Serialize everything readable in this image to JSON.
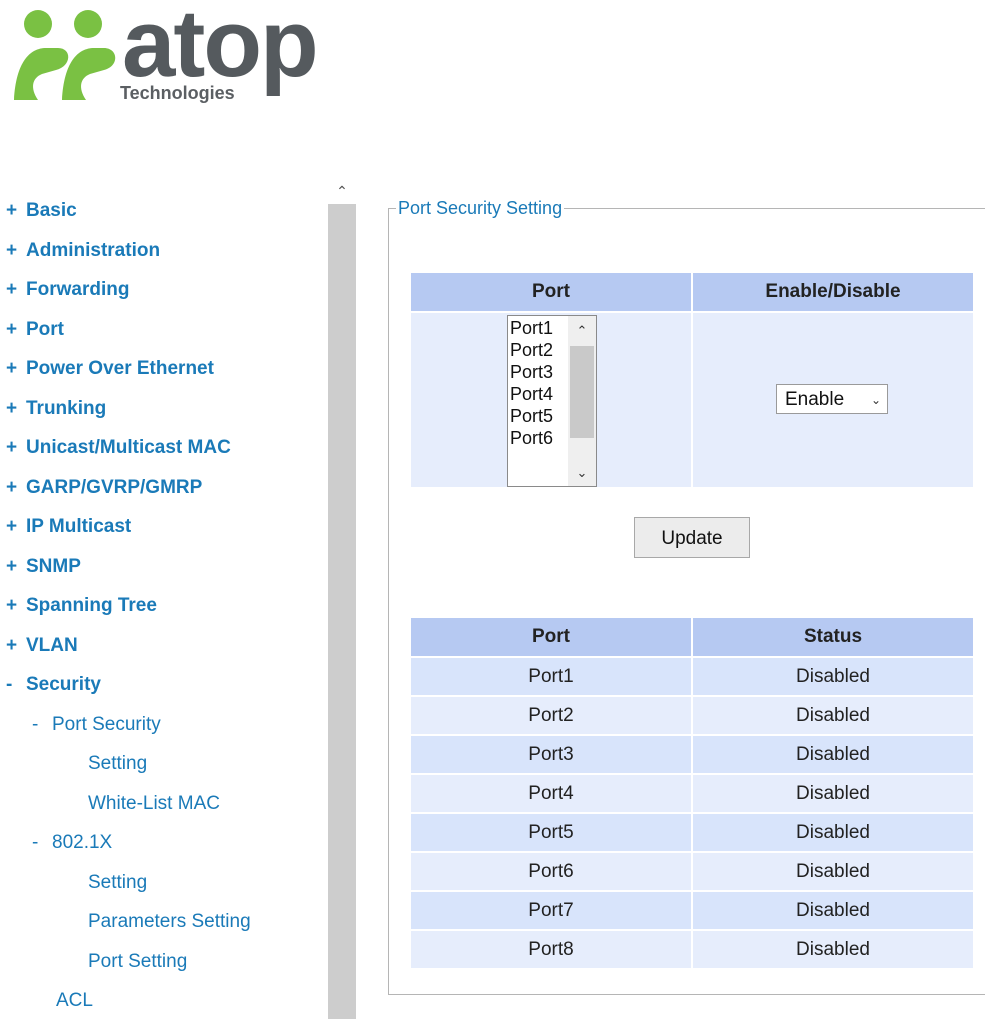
{
  "logo": {
    "wordmark": "atop",
    "tagline": "Technologies",
    "brand_color": "#7ac143",
    "text_color": "#555a5e"
  },
  "sidebar": {
    "items": [
      {
        "sign": "+",
        "label": "Basic"
      },
      {
        "sign": "+",
        "label": "Administration"
      },
      {
        "sign": "+",
        "label": "Forwarding"
      },
      {
        "sign": "+",
        "label": "Port"
      },
      {
        "sign": "+",
        "label": "Power Over Ethernet"
      },
      {
        "sign": "+",
        "label": "Trunking"
      },
      {
        "sign": "+",
        "label": "Unicast/Multicast MAC"
      },
      {
        "sign": "+",
        "label": "GARP/GVRP/GMRP"
      },
      {
        "sign": "+",
        "label": "IP Multicast"
      },
      {
        "sign": "+",
        "label": "SNMP"
      },
      {
        "sign": "+",
        "label": "Spanning Tree"
      },
      {
        "sign": "+",
        "label": "VLAN"
      },
      {
        "sign": "-",
        "label": "Security"
      }
    ],
    "security_children": [
      {
        "sign": "-",
        "label": "Port Security"
      },
      {
        "sign": "",
        "label": "Setting"
      },
      {
        "sign": "",
        "label": "White-List MAC"
      },
      {
        "sign": "-",
        "label": "802.1X"
      },
      {
        "sign": "",
        "label": "Setting"
      },
      {
        "sign": "",
        "label": "Parameters Setting"
      },
      {
        "sign": "",
        "label": "Port Setting"
      },
      {
        "sign": "",
        "label": "ACL"
      }
    ],
    "scroll_up_icon": "chevron-up-icon",
    "link_color": "#1a7ab8"
  },
  "panel": {
    "legend": "Port Security Setting",
    "config_table": {
      "col_port": "Port",
      "col_enable": "Enable/Disable",
      "port_options": [
        "Port1",
        "Port2",
        "Port3",
        "Port4",
        "Port5",
        "Port6"
      ],
      "enable_value": "Enable"
    },
    "update_button": "Update",
    "status_table": {
      "col_port": "Port",
      "col_status": "Status",
      "rows": [
        {
          "port": "Port1",
          "status": "Disabled"
        },
        {
          "port": "Port2",
          "status": "Disabled"
        },
        {
          "port": "Port3",
          "status": "Disabled"
        },
        {
          "port": "Port4",
          "status": "Disabled"
        },
        {
          "port": "Port5",
          "status": "Disabled"
        },
        {
          "port": "Port6",
          "status": "Disabled"
        },
        {
          "port": "Port7",
          "status": "Disabled"
        },
        {
          "port": "Port8",
          "status": "Disabled"
        }
      ]
    },
    "header_color": "#b6c9f2",
    "row_color": "#d8e4fb"
  }
}
